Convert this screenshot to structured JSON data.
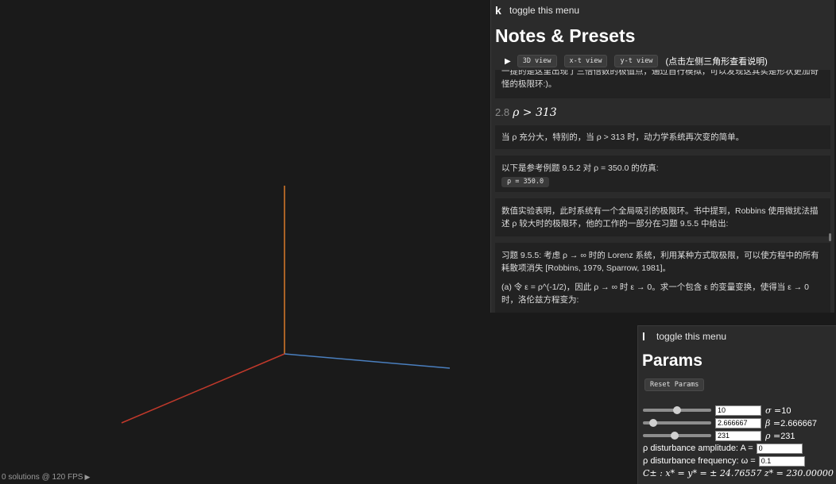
{
  "status": {
    "text": "0 solutions @ 120 FPS",
    "play_icon": "play-icon"
  },
  "axes": {
    "x_color": "#c0392b",
    "y_color": "#d97b2b",
    "z_color": "#4a7fbf"
  },
  "notes_panel": {
    "menu_key": "k",
    "menu_label": "toggle this menu",
    "title": "Notes & Presets",
    "views": [
      "3D view",
      "x-t view",
      "y-t view"
    ],
    "view_hint": "(点击左侧三角形查看说明)",
    "para1": "一提的是这里出现了三倍倍数的极值点，通过自行模拟，可以发现这其实是形状更加奇怪的极限环:)。",
    "section_number": "2.8",
    "section_title": "ρ > 313",
    "para2": "当 ρ 充分大，特别的，当 ρ > 313 时，动力学系统再次变的简单。",
    "para3": "以下是参考例题 9.5.2 对 ρ = 350.0 的仿真:",
    "preset_button": "ρ = 350.0",
    "para4": "数值实验表明，此时系统有一个全局吸引的极限环。书中提到，Robbins 使用微扰法描述 ρ 较大时的极限环，他的工作的一部分在习题 9.5.5 中给出:",
    "exercise": "习题 9.5.5: 考虑 ρ → ∞ 时的 Lorenz 系统，利用某种方式取极限，可以使方程中的所有耗散项消失 [Robbins, 1979, Sparrow, 1981]。",
    "exercise_a": "(a) 令 ε = ρ^(-1/2)，因此 ρ → ∞ 时 ε → 0。求一个包含 ε 的变量变换，使得当 ε → 0 时，洛伦兹方程变为:"
  },
  "params_panel": {
    "menu_key": "l",
    "menu_label": "toggle this menu",
    "title": "Params",
    "reset_label": "Reset Params",
    "sigma": {
      "value": "10",
      "label": "σ =",
      "display": "10",
      "slider_fraction": 0.5
    },
    "beta": {
      "value": "2.666667",
      "label": "β =",
      "display": "2.666667",
      "slider_fraction": 0.15
    },
    "rho": {
      "value": "231",
      "label": "ρ =",
      "display": "231",
      "slider_fraction": 0.46
    },
    "amp_label": "ρ disturbance amplitude: A =",
    "amp_value": "0",
    "freq_label": "ρ disturbance frequency: ω =",
    "freq_value": "0.1",
    "fixed_points": "C± : x* = y* = ± 24.76557  z* = 230.00000"
  }
}
